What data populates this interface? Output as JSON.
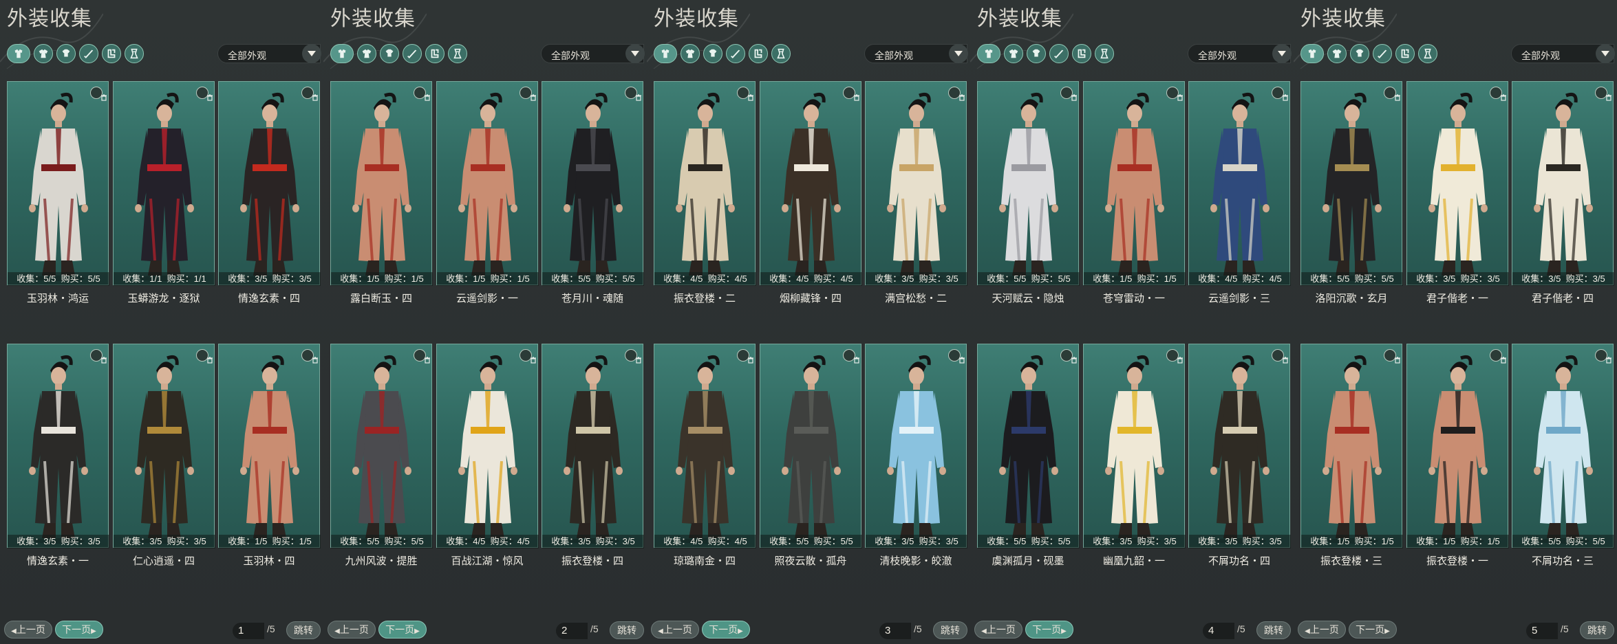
{
  "colors": {
    "background": "#2b2f30",
    "card_bg": "#316a61",
    "accent": "#4f9586",
    "card_border": "#76a89b"
  },
  "icon_names": [
    "all-outfits-icon",
    "robe-icon",
    "top-icon",
    "hat-icon",
    "sword-icon",
    "boots-icon"
  ],
  "panels": [
    {
      "title": "外装收集",
      "filter": "全部外观",
      "prev_label": "上一页",
      "next_label": "下一页",
      "next_active": true,
      "page": "1",
      "total": "/5",
      "jump_label": "跳转",
      "cards": [
        {
          "collect": "收集：5/5",
          "buy": "购买：5/5",
          "name": "玉羽林・鸿运",
          "outfit": "#d9d6cf",
          "accent": "#7a1c1c"
        },
        {
          "collect": "收集：1/1",
          "buy": "购买：1/1",
          "name": "玉蟒游龙・逐狱",
          "outfit": "#24212a",
          "accent": "#b8202a"
        },
        {
          "collect": "收集：3/5",
          "buy": "购买：3/5",
          "name": "情逸玄素・四",
          "outfit": "#2a2424",
          "accent": "#c42a1e"
        },
        {
          "collect": "收集：3/5",
          "buy": "购买：3/5",
          "name": "情逸玄素・一",
          "outfit": "#2b2a28",
          "accent": "#e8e4dc"
        },
        {
          "collect": "收集：3/5",
          "buy": "购买：3/5",
          "name": "仁心逍遥・四",
          "outfit": "#2e2a22",
          "accent": "#b08a3a"
        },
        {
          "collect": "收集：1/5",
          "buy": "购买：1/5",
          "name": "玉羽林・四",
          "outfit": "#c98d72",
          "accent": "#a82e22"
        }
      ]
    },
    {
      "title": "外装收集",
      "filter": "全部外观",
      "prev_label": "上一页",
      "next_label": "下一页",
      "next_active": true,
      "page": "2",
      "total": "/5",
      "jump_label": "跳转",
      "cards": [
        {
          "collect": "收集：1/5",
          "buy": "购买：1/5",
          "name": "露白断玉・四",
          "outfit": "#c98d72",
          "accent": "#a82e22"
        },
        {
          "collect": "收集：1/5",
          "buy": "购买：1/5",
          "name": "云遥剑影・一",
          "outfit": "#c98d72",
          "accent": "#a82e22"
        },
        {
          "collect": "收集：5/5",
          "buy": "购买：5/5",
          "name": "苍月川・魂随",
          "outfit": "#1f1f22",
          "accent": "#4a4a50"
        },
        {
          "collect": "收集：5/5",
          "buy": "购买：5/5",
          "name": "九州风波・提胜",
          "outfit": "#4b4b4f",
          "accent": "#9a2424"
        },
        {
          "collect": "收集：4/5",
          "buy": "购买：4/5",
          "name": "百战江湖・惊风",
          "outfit": "#ebe6da",
          "accent": "#e0a418"
        },
        {
          "collect": "收集：3/5",
          "buy": "购买：3/5",
          "name": "振衣登楼・四",
          "outfit": "#2d2923",
          "accent": "#cfc6a8"
        }
      ]
    },
    {
      "title": "外装收集",
      "filter": "全部外观",
      "prev_label": "上一页",
      "next_label": "下一页",
      "next_active": true,
      "page": "3",
      "total": "/5",
      "jump_label": "跳转",
      "cards": [
        {
          "collect": "收集：4/5",
          "buy": "购买：4/5",
          "name": "振衣登楼・二",
          "outfit": "#d8cbb0",
          "accent": "#2a2620"
        },
        {
          "collect": "收集：4/5",
          "buy": "购买：4/5",
          "name": "烟柳藏锋・四",
          "outfit": "#3b3026",
          "accent": "#efe9dc"
        },
        {
          "collect": "收集：3/5",
          "buy": "购买：3/5",
          "name": "满宫松愁・二",
          "outfit": "#e7dfcc",
          "accent": "#c8a466"
        },
        {
          "collect": "收集：4/5",
          "buy": "购买：4/5",
          "name": "琼璐南金・四",
          "outfit": "#3a332a",
          "accent": "#a68e66"
        },
        {
          "collect": "收集：5/5",
          "buy": "购买：5/5",
          "name": "照夜云散・孤舟",
          "outfit": "#3e403e",
          "accent": "#5a5c58"
        },
        {
          "collect": "收集：3/5",
          "buy": "购买：3/5",
          "name": "清枝晚影・皎澈",
          "outfit": "#8ac2df",
          "accent": "#e4f2f8"
        }
      ]
    },
    {
      "title": "外装收集",
      "filter": "全部外观",
      "prev_label": "上一页",
      "next_label": "下一页",
      "next_active": true,
      "page": "4",
      "total": "/5",
      "jump_label": "跳转",
      "cards": [
        {
          "collect": "收集：5/5",
          "buy": "购买：5/5",
          "name": "天河赋云・隐烛",
          "outfit": "#dcdcde",
          "accent": "#9a9aa0"
        },
        {
          "collect": "收集：1/5",
          "buy": "购买：1/5",
          "name": "苍穹雷动・一",
          "outfit": "#c98d72",
          "accent": "#a82e22"
        },
        {
          "collect": "收集：4/5",
          "buy": "购买：4/5",
          "name": "云遥剑影・三",
          "outfit": "#2f4a7c",
          "accent": "#d8d4c8"
        },
        {
          "collect": "收集：5/5",
          "buy": "购买：5/5",
          "name": "虞渊孤月・砚墨",
          "outfit": "#1c1c1f",
          "accent": "#2c3a6a"
        },
        {
          "collect": "收集：3/5",
          "buy": "购买：3/5",
          "name": "幽凰九韶・一",
          "outfit": "#efe8d6",
          "accent": "#e2b62a"
        },
        {
          "collect": "收集：3/5",
          "buy": "购买：3/5",
          "name": "不屑功名・四",
          "outfit": "#2f2b24",
          "accent": "#d6ccb2"
        }
      ]
    },
    {
      "title": "外装收集",
      "filter": "全部外观",
      "prev_label": "上一页",
      "next_label": "下一页",
      "next_active": false,
      "page": "5",
      "total": "/5",
      "jump_label": "跳转",
      "cards": [
        {
          "collect": "收集：5/5",
          "buy": "购买：5/5",
          "name": "洛阳沉歌・玄月",
          "outfit": "#242426",
          "accent": "#a58d52"
        },
        {
          "collect": "收集：3/5",
          "buy": "购买：3/5",
          "name": "君子偕老・一",
          "outfit": "#f0ead8",
          "accent": "#e2b12e"
        },
        {
          "collect": "收集：3/5",
          "buy": "购买：3/5",
          "name": "君子偕老・四",
          "outfit": "#ebe5d5",
          "accent": "#2b2822"
        },
        {
          "collect": "收集：1/5",
          "buy": "购买：1/5",
          "name": "振衣登楼・三",
          "outfit": "#c98d72",
          "accent": "#a82e22"
        },
        {
          "collect": "收集：1/5",
          "buy": "购买：1/5",
          "name": "振衣登楼・一",
          "outfit": "#c98d72",
          "accent": "#1f1d1d"
        },
        {
          "collect": "收集：5/5",
          "buy": "购买：5/5",
          "name": "不屑功名・三",
          "outfit": "#cfe6ef",
          "accent": "#6fa8c8"
        }
      ]
    }
  ]
}
